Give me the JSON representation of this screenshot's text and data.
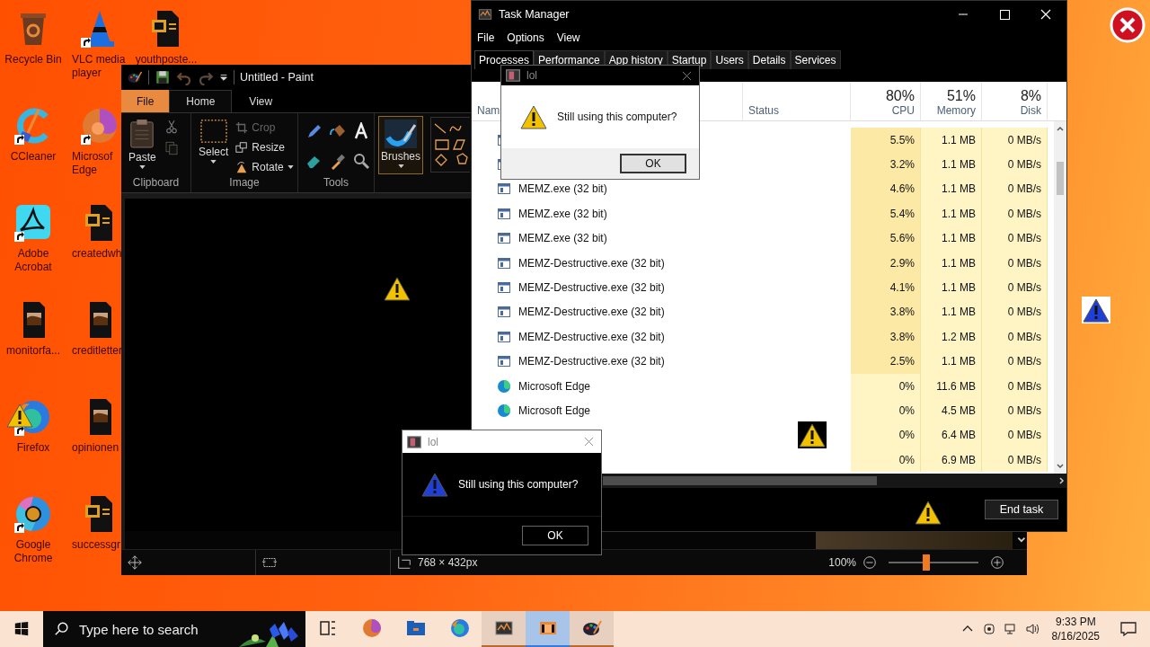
{
  "desktop": {
    "icon_columns": [
      {
        "icons": [
          {
            "label": "Recycle Bin",
            "kind": "recycle"
          },
          {
            "label": "CCleaner",
            "kind": "ccleaner"
          },
          {
            "label": "Adobe Acrobat",
            "kind": "acrobat"
          },
          {
            "label": "monitorfa...",
            "kind": "image"
          },
          {
            "label": "Firefox",
            "kind": "firefox"
          },
          {
            "label": "Google Chrome",
            "kind": "chrome"
          }
        ]
      },
      {
        "icons": [
          {
            "label": "VLC media player",
            "kind": "vlc"
          },
          {
            "label": "Microsof Edge",
            "kind": "edge"
          },
          {
            "label": "createdwh",
            "kind": "word"
          },
          {
            "label": "creditletter",
            "kind": "image"
          },
          {
            "label": "opinionen",
            "kind": "image"
          },
          {
            "label": "successgr",
            "kind": "word"
          }
        ]
      },
      {
        "icons": [
          {
            "label": "youthposte...",
            "kind": "word"
          }
        ]
      }
    ]
  },
  "paint": {
    "title": "Untitled - Paint",
    "tabs": [
      {
        "label": "File",
        "kind": "file",
        "selected": false
      },
      {
        "label": "Home",
        "kind": "tab",
        "selected": true
      },
      {
        "label": "View",
        "kind": "tab",
        "selected": false
      }
    ],
    "clipboard": {
      "label": "Clipboard",
      "paste": "Paste"
    },
    "image": {
      "label": "Image",
      "select": "Select",
      "commands": [
        {
          "label": "Crop",
          "disabled": true,
          "dropdown": false
        },
        {
          "label": "Resize",
          "disabled": false,
          "dropdown": false
        },
        {
          "label": "Rotate",
          "disabled": false,
          "dropdown": true
        }
      ]
    },
    "tools": {
      "label": "Tools"
    },
    "brushes": {
      "label": "Brushes",
      "selected": true
    },
    "status": {
      "size": "768 × 432px",
      "zoom": "100%",
      "zoom_slider": {
        "level": 0.42
      }
    }
  },
  "task_manager": {
    "title": "Task Manager",
    "menu": [
      "File",
      "Options",
      "View"
    ],
    "tabs": [
      {
        "label": "Processes",
        "selected": true
      },
      {
        "label": "Performance",
        "selected": false
      },
      {
        "label": "App history",
        "selected": false
      },
      {
        "label": "Startup",
        "selected": false
      },
      {
        "label": "Users",
        "selected": false
      },
      {
        "label": "Details",
        "selected": false
      },
      {
        "label": "Services",
        "selected": false
      }
    ],
    "columns": [
      {
        "label": "Nam"
      },
      {
        "label": "Status"
      },
      {
        "usage": "80%",
        "label": "CPU"
      },
      {
        "usage": "51%",
        "label": "Memory"
      },
      {
        "usage": "8%",
        "label": "Disk"
      }
    ],
    "rows": [
      {
        "kind": "memz",
        "cpu": "5.5%",
        "memory": "1.1 MB",
        "disk": "0 MB/s",
        "color": "#fce9a6"
      },
      {
        "kind": "memz",
        "cpu": "3.2%",
        "memory": "1.1 MB",
        "disk": "0 MB/s",
        "color": "#fce9a6"
      },
      {
        "kind": "memz",
        "name": "MEMZ.exe (32 bit)",
        "cpu": "4.6%",
        "memory": "1.1 MB",
        "disk": "0 MB/s",
        "color": "#fce9a6"
      },
      {
        "kind": "memz",
        "name": "MEMZ.exe (32 bit)",
        "cpu": "5.4%",
        "memory": "1.1 MB",
        "disk": "0 MB/s",
        "color": "#fce9a6"
      },
      {
        "kind": "memz",
        "name": "MEMZ.exe (32 bit)",
        "cpu": "5.6%",
        "memory": "1.1 MB",
        "disk": "0 MB/s",
        "color": "#fce9a6"
      },
      {
        "kind": "memz",
        "name": "MEMZ-Destructive.exe (32 bit)",
        "cpu": "2.9%",
        "memory": "1.1 MB",
        "disk": "0 MB/s",
        "color": "#fce9a6"
      },
      {
        "kind": "memz",
        "name": "MEMZ-Destructive.exe (32 bit)",
        "cpu": "4.1%",
        "memory": "1.1 MB",
        "disk": "0 MB/s",
        "color": "#fce9a6"
      },
      {
        "kind": "memz",
        "name": "MEMZ-Destructive.exe (32 bit)",
        "cpu": "3.8%",
        "memory": "1.1 MB",
        "disk": "0 MB/s",
        "color": "#fce9a6"
      },
      {
        "kind": "memz",
        "name": "MEMZ-Destructive.exe (32 bit)",
        "cpu": "3.8%",
        "memory": "1.2 MB",
        "disk": "0 MB/s",
        "color": "#fce9a6"
      },
      {
        "kind": "memz",
        "name": "MEMZ-Destructive.exe (32 bit)",
        "cpu": "2.5%",
        "memory": "1.1 MB",
        "disk": "0 MB/s",
        "color": "#fce9a6"
      },
      {
        "kind": "edge",
        "name": "Microsoft Edge",
        "cpu": "0%",
        "memory": "11.6 MB",
        "disk": "0 MB/s",
        "color": "#fff4c4"
      },
      {
        "kind": "edge",
        "name": "Microsoft Edge",
        "cpu": "0%",
        "memory": "4.5 MB",
        "disk": "0 MB/s",
        "color": "#fff4c4"
      },
      {
        "cpu": "0%",
        "memory": "6.4 MB",
        "disk": "0 MB/s",
        "color": "#fff4c4"
      },
      {
        "cpu": "0%",
        "memory": "6.9 MB",
        "disk": "0 MB/s",
        "color": "#fff4c4"
      }
    ],
    "end_task": "End task"
  },
  "dialogs": [
    {
      "kind": "light",
      "title": "lol",
      "message": "Still using this computer?",
      "button": "OK",
      "color": "#f2c200"
    },
    {
      "kind": "dark",
      "title": "lol",
      "message": "Still using this computer?",
      "button": "OK",
      "color": "#1f3fd6"
    }
  ],
  "taskbar": {
    "search_placeholder": "Type here to search",
    "apps": [
      {
        "kind": "taskview",
        "open": false,
        "selected": false
      },
      {
        "kind": "edge",
        "open": false,
        "selected": false
      },
      {
        "kind": "explorer",
        "open": false,
        "selected": false
      },
      {
        "kind": "firefox",
        "open": false,
        "selected": false
      },
      {
        "kind": "taskmgr",
        "open": true,
        "selected": false
      },
      {
        "kind": "memz",
        "open": true,
        "selected": true
      },
      {
        "kind": "paint",
        "open": true,
        "selected": false
      }
    ],
    "time": "9:33 PM",
    "date": "8/16/2025"
  }
}
